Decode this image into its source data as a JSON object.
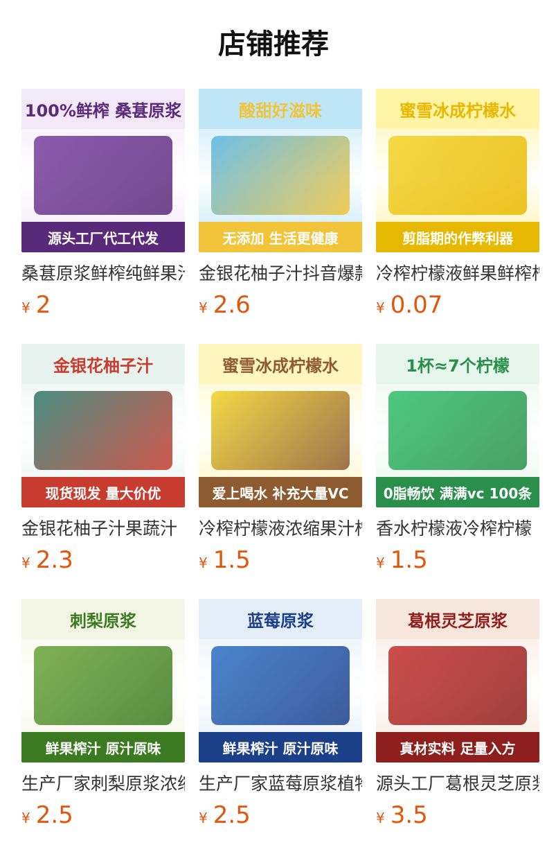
{
  "page": {
    "title": "店铺推荐"
  },
  "products": [
    {
      "name": "桑葚原浆鲜榨纯鲜果汁",
      "currency": "¥",
      "price": "2",
      "img": {
        "top": "100%鲜榨 桑葚原浆",
        "bottom": "源头工厂代工代发",
        "c1": "#7a3f9e",
        "c2": "#f3e8f7",
        "accent": "#5a2a7a"
      }
    },
    {
      "name": "金银花柚子汁抖音爆款",
      "currency": "¥",
      "price": "2.6",
      "img": {
        "top": "酸甜好滋味",
        "bottom": "无添加 生活更健康",
        "c1": "#57b6e6",
        "c2": "#bfe6f7",
        "accent": "#f1c43a"
      }
    },
    {
      "name": "冷榨柠檬液鲜果鲜榨柠",
      "currency": "¥",
      "price": "0.07",
      "img": {
        "top": "蜜雪冰成柠檬水",
        "bottom": "剪脂期的作弊利器",
        "c1": "#f2d22a",
        "c2": "#fff3a6",
        "accent": "#e7b800"
      }
    },
    {
      "name": "金银花柚子汁果蔬汁",
      "currency": "¥",
      "price": "2.3",
      "img": {
        "top": "金银花柚子汁",
        "bottom": "现货现发 量大价优",
        "c1": "#2c7a6c",
        "c2": "#e8f3ef",
        "accent": "#c83b2f"
      }
    },
    {
      "name": "冷榨柠檬液浓缩果汁柠",
      "currency": "¥",
      "price": "1.5",
      "img": {
        "top": "蜜雪冰成柠檬水",
        "bottom": "爱上喝水 补充大量VC",
        "c1": "#f2d22a",
        "c2": "#fff6bd",
        "accent": "#8d5b2f"
      }
    },
    {
      "name": "香水柠檬液冷榨柠檬",
      "currency": "¥",
      "price": "1.5",
      "img": {
        "top": "1杯≈7个柠檬",
        "bottom": "0脂畅饮 满满vc 100条",
        "c1": "#2fbf6b",
        "c2": "#e7f6ec",
        "accent": "#2a8f4b"
      }
    },
    {
      "name": "生产厂家刺梨原浆浓缩",
      "currency": "¥",
      "price": "2.5",
      "img": {
        "top": "刺梨原浆",
        "bottom": "鲜果榨汁 原汁原味",
        "c1": "#6aa33a",
        "c2": "#f3f6e4",
        "accent": "#3b7a20"
      }
    },
    {
      "name": "生产厂家蓝莓原浆植物",
      "currency": "¥",
      "price": "2.5",
      "img": {
        "top": "蓝莓原浆",
        "bottom": "鲜果榨汁 原汁原味",
        "c1": "#2c6fc4",
        "c2": "#e4eef9",
        "accent": "#1c3f8a"
      }
    },
    {
      "name": "源头工厂葛根灵芝原浆",
      "currency": "¥",
      "price": "3.5",
      "img": {
        "top": "葛根灵芝原浆",
        "bottom": "真材实料 足量入方",
        "c1": "#c2302e",
        "c2": "#f6e6dc",
        "accent": "#8f1f1d"
      }
    }
  ]
}
